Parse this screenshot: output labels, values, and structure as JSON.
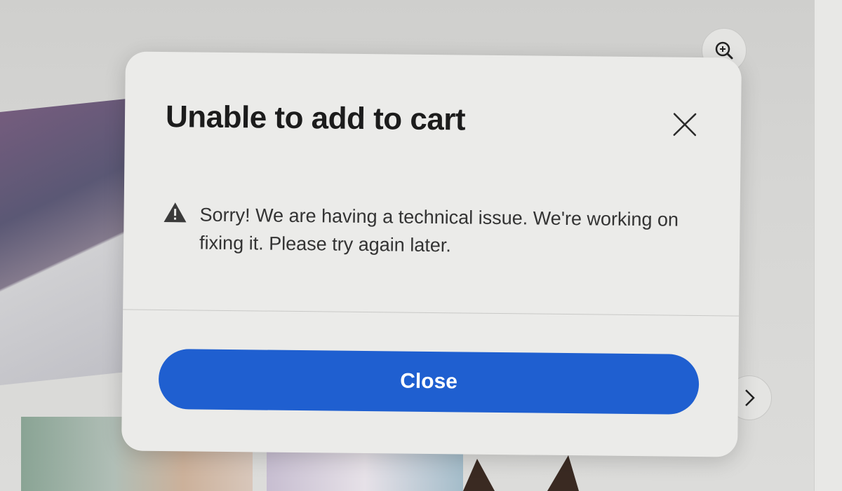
{
  "dialog": {
    "title": "Unable to add to cart",
    "close_icon": "close-icon",
    "warning_icon": "warning-icon",
    "message": "Sorry! We are having a technical issue. We're working on fixing it. Please try again later.",
    "close_button_label": "Close"
  },
  "background": {
    "zoom_icon": "zoom-in-icon",
    "next_icon": "chevron-right-icon"
  },
  "colors": {
    "primary_button": "#1f5fd0",
    "dialog_background": "#ebebe9",
    "title_text": "#1c1c1c"
  }
}
